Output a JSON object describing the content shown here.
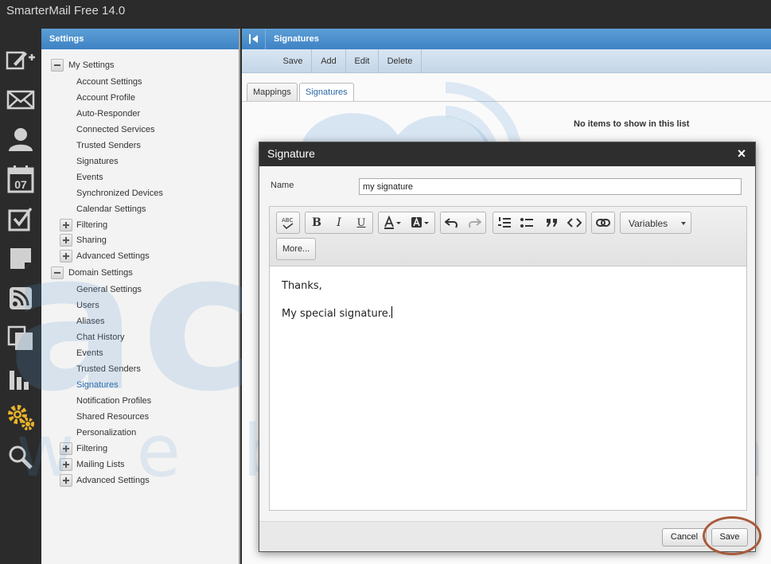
{
  "app": {
    "title": "SmarterMail Free 14.0"
  },
  "rail": {
    "icons": [
      "compose-icon",
      "mail-icon",
      "contacts-icon",
      "calendar-icon",
      "tasks-icon",
      "notes-icon",
      "rss-icon",
      "files-icon",
      "reports-icon",
      "settings-icon",
      "search-icon"
    ],
    "calendar_day": "07"
  },
  "settings_panel": {
    "title": "Settings",
    "my_settings": {
      "label": "My Settings",
      "items": [
        "Account Settings",
        "Account Profile",
        "Auto-Responder",
        "Connected Services",
        "Trusted Senders",
        "Signatures",
        "Events",
        "Synchronized Devices",
        "Calendar Settings"
      ],
      "collapsed": [
        "Filtering",
        "Sharing",
        "Advanced Settings"
      ]
    },
    "domain_settings": {
      "label": "Domain Settings",
      "items": [
        "General Settings",
        "Users",
        "Aliases",
        "Chat History",
        "Events",
        "Trusted Senders",
        "Signatures",
        "Notification Profiles",
        "Shared Resources",
        "Personalization"
      ],
      "collapsed": [
        "Filtering",
        "Mailing Lists",
        "Advanced Settings"
      ],
      "selected": "Signatures"
    }
  },
  "main": {
    "title": "Signatures",
    "toolbar": {
      "save": "Save",
      "add": "Add",
      "edit": "Edit",
      "delete": "Delete"
    },
    "tabs": [
      "Mappings",
      "Signatures"
    ],
    "active_tab": "Signatures",
    "empty_message": "No items to show in this list"
  },
  "dialog": {
    "title": "Signature",
    "close": "×",
    "name_label": "Name",
    "name_value": "my signature",
    "toolbar": {
      "spellcheck": "ABC",
      "bold": "B",
      "italic": "I",
      "underline": "U",
      "variables": "Variables",
      "more": "More..."
    },
    "body_lines": [
      "Thanks,",
      "My special signature."
    ],
    "cancel": "Cancel",
    "save": "Save"
  },
  "watermark": {
    "main": "accu",
    "sub1": "web",
    "sub2": "hosting"
  },
  "colors": {
    "header_blue": "#3d82c4",
    "accent_link": "#2a67a8",
    "highlight_ring": "#a85a3a"
  }
}
